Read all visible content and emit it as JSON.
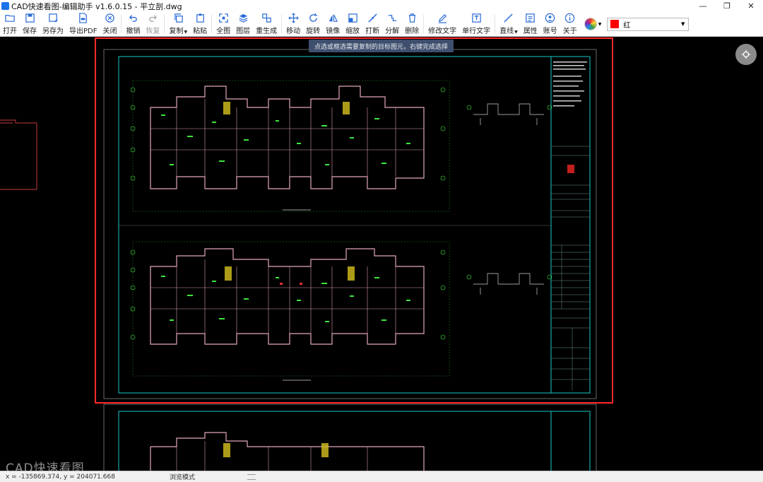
{
  "window": {
    "title": "CAD快速看图-编辑助手 v1.6.0.15 - 平立剖.dwg",
    "minimize": "—",
    "maximize": "❐",
    "close": "✕"
  },
  "toolbar": {
    "open": "打开",
    "save": "保存",
    "save_as": "另存为",
    "export_pdf": "导出PDF",
    "close": "关闭",
    "undo": "撤销",
    "redo": "恢复",
    "copy": "复制",
    "paste": "粘贴",
    "fit_all": "全图",
    "layers": "图层",
    "regen": "重生成",
    "move": "移动",
    "rotate": "旋转",
    "mirror": "镜像",
    "scale": "缩放",
    "break": "打断",
    "explode": "分解",
    "delete": "删除",
    "edit_text": "修改文字",
    "single_text": "单行文字",
    "line": "直线",
    "properties": "属性",
    "account": "账号",
    "about": "关于",
    "color_label": "红",
    "color_value": "#ff0000"
  },
  "canvas": {
    "hint": "点选或框选需要复制的目标图元，右键完成选择",
    "selection_color": "#ff2a2a",
    "frame_color": "#19c7c7"
  },
  "watermark": "CAD快速看图",
  "statusbar": {
    "coords": "x = -135869.374, y = 204071.668",
    "mode": "浏览模式"
  }
}
